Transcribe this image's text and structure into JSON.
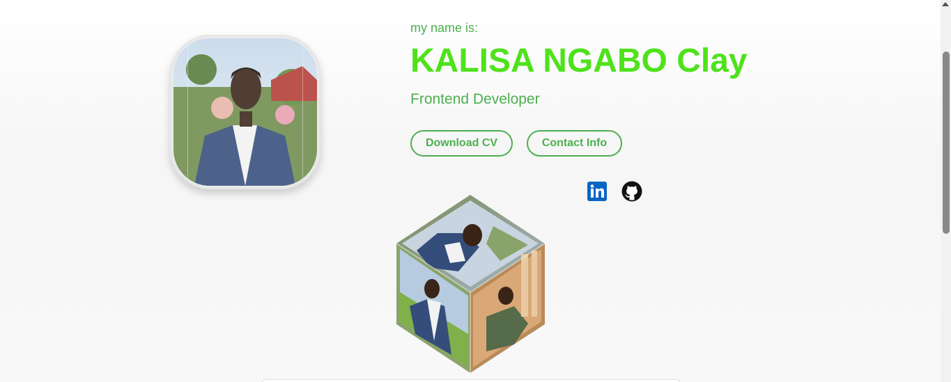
{
  "hero": {
    "intro": "my name is:",
    "name": "KALISA NGABO Clay",
    "role": "Frontend Developer",
    "buttons": {
      "download_cv": "Download CV",
      "contact_info": "Contact Info"
    }
  },
  "social": [
    {
      "icon": "linkedin-icon",
      "color": "#0a66c2"
    },
    {
      "icon": "github-icon",
      "color": "#111111"
    }
  ],
  "colors": {
    "accent": "#4caf50",
    "name": "#4ee21b"
  }
}
